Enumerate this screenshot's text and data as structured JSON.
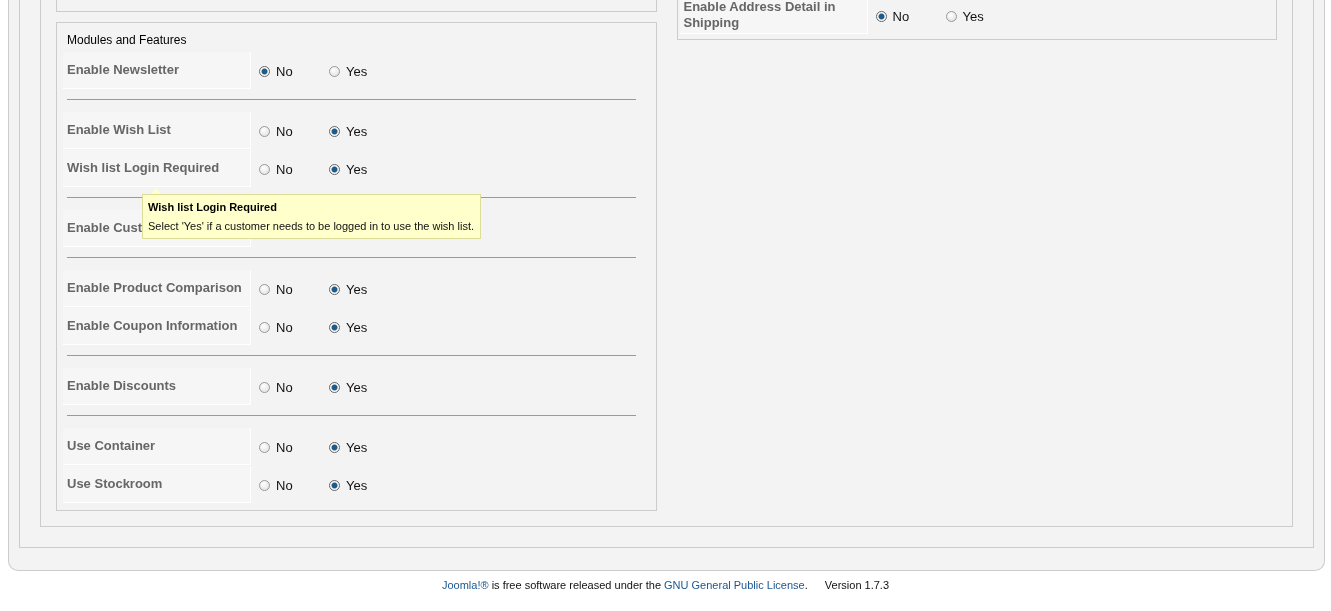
{
  "left_panel": {
    "legend": "Modules and Features",
    "groups": [
      [
        {
          "label": "Enable Newsletter",
          "options": [
            {
              "label": "No",
              "selected": true
            },
            {
              "label": "Yes",
              "selected": false
            }
          ]
        }
      ],
      [
        {
          "label": "Enable Wish List",
          "options": [
            {
              "label": "No",
              "selected": false
            },
            {
              "label": "Yes",
              "selected": true
            }
          ]
        },
        {
          "label": "Wish list Login Required",
          "options": [
            {
              "label": "No",
              "selected": false
            },
            {
              "label": "Yes",
              "selected": true
            }
          ]
        }
      ],
      [
        {
          "label": "Enable Cust"
        }
      ],
      [
        {
          "label": "Enable Product Comparison",
          "options": [
            {
              "label": "No",
              "selected": false
            },
            {
              "label": "Yes",
              "selected": true
            }
          ]
        },
        {
          "label": "Enable Coupon Information",
          "options": [
            {
              "label": "No",
              "selected": false
            },
            {
              "label": "Yes",
              "selected": true
            }
          ]
        }
      ],
      [
        {
          "label": "Enable Discounts",
          "options": [
            {
              "label": "No",
              "selected": false
            },
            {
              "label": "Yes",
              "selected": true
            }
          ]
        }
      ],
      [
        {
          "label": "Use Container",
          "options": [
            {
              "label": "No",
              "selected": false
            },
            {
              "label": "Yes",
              "selected": true
            }
          ]
        },
        {
          "label": "Use Stockroom",
          "options": [
            {
              "label": "No",
              "selected": false
            },
            {
              "label": "Yes",
              "selected": true
            }
          ]
        }
      ]
    ],
    "tooltip": {
      "title": "Wish list Login Required",
      "text": "Select 'Yes' if a customer needs to be logged in to use the wish list."
    }
  },
  "right_panel": {
    "rows": [
      {
        "label": "Enable Address Detail in Shipping",
        "options": [
          {
            "label": "No",
            "selected": true
          },
          {
            "label": "Yes",
            "selected": false
          }
        ]
      }
    ]
  },
  "footer": {
    "brand_link": "Joomla!®",
    "text": " is free software released under the ",
    "license_link": "GNU General Public License",
    "end": ".",
    "version": "Version 1.7.3"
  }
}
